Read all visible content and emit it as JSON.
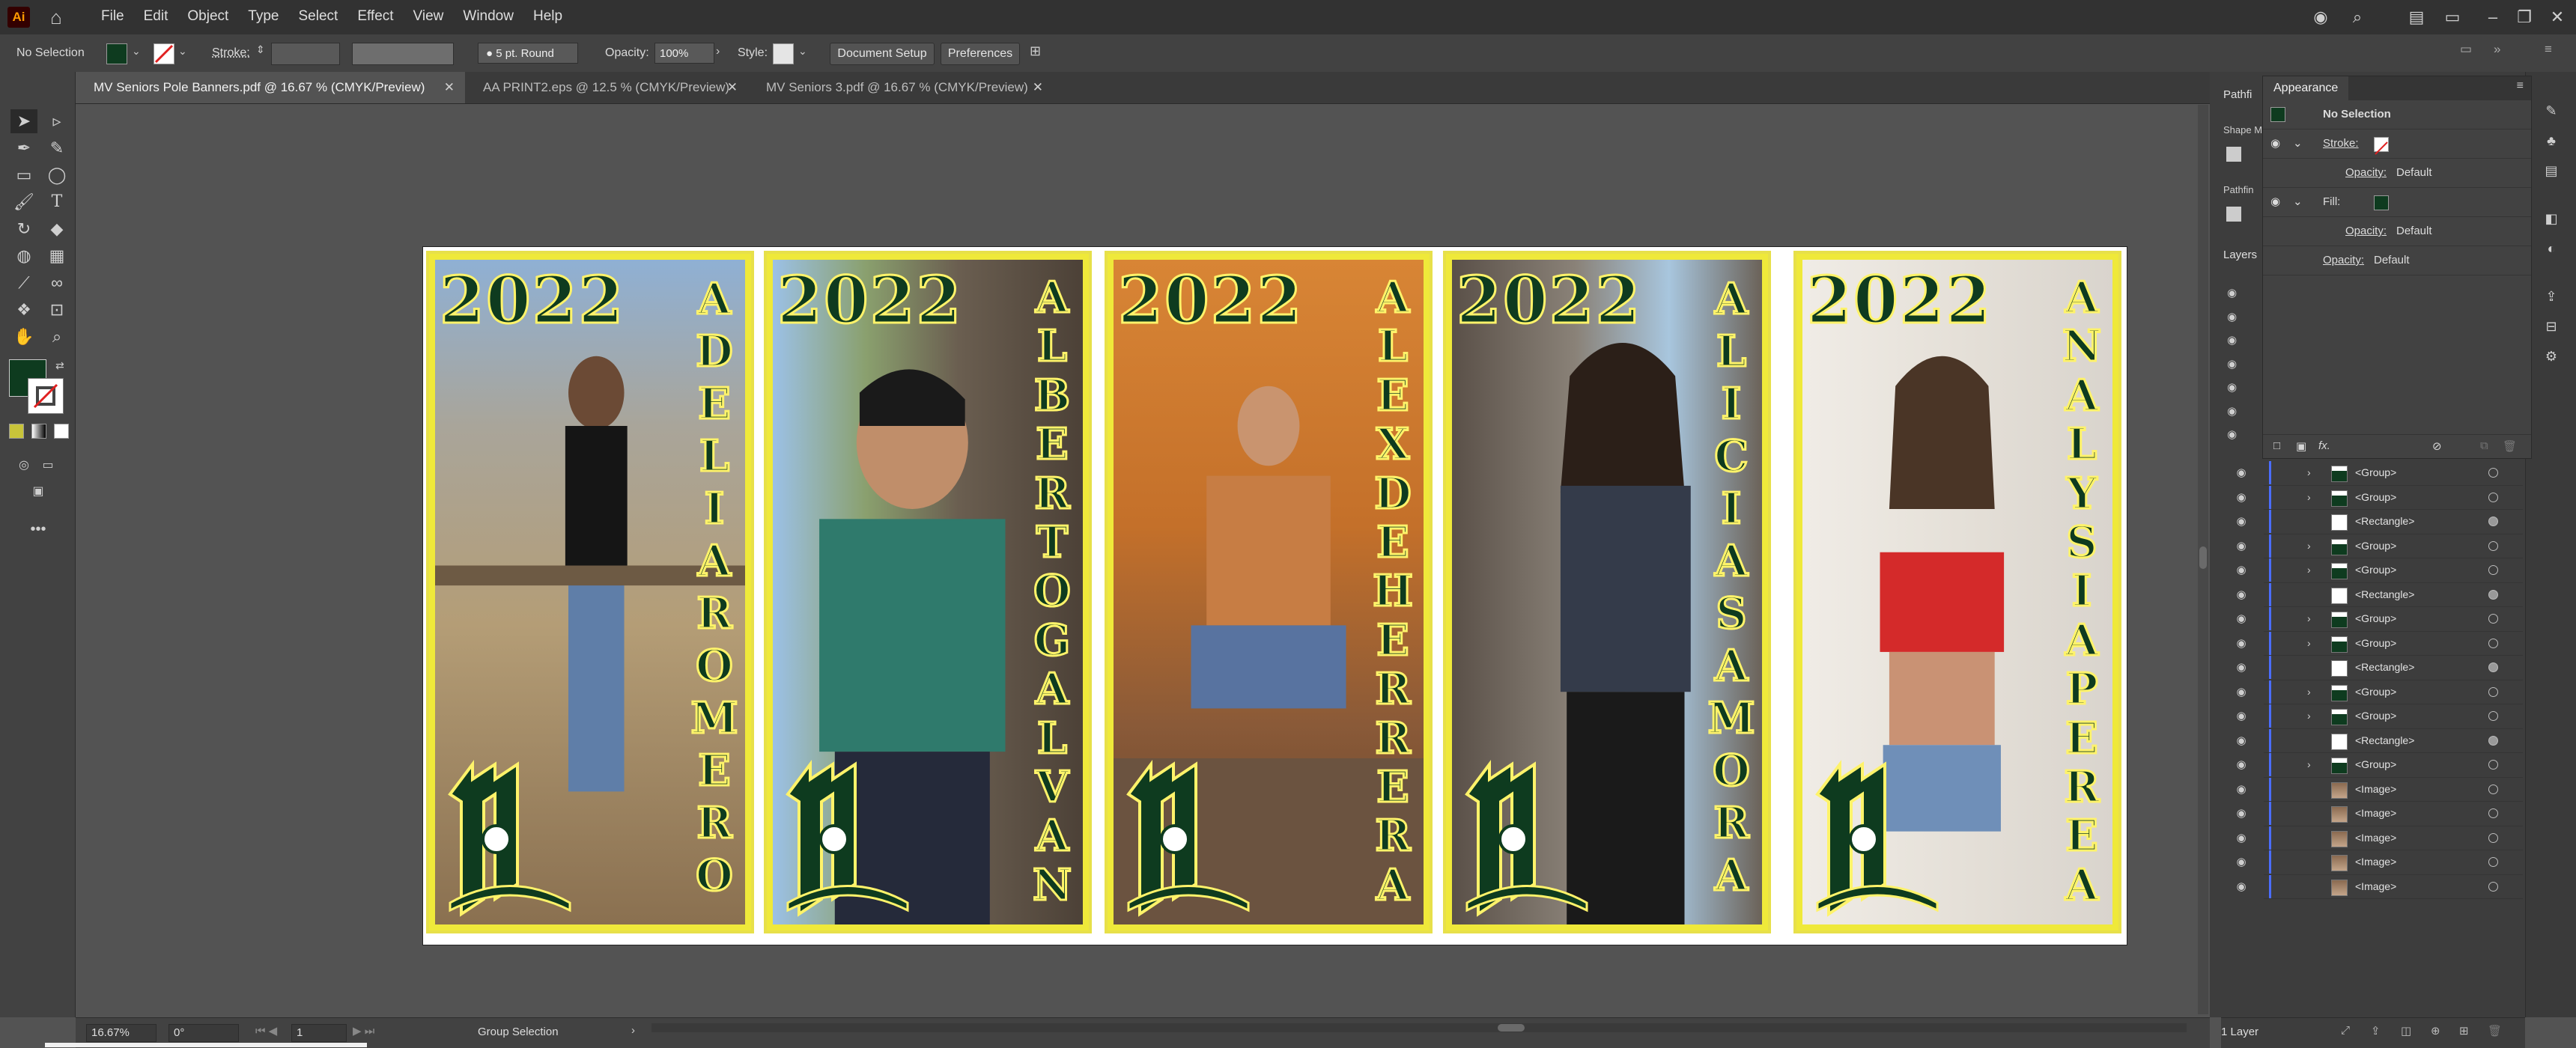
{
  "app": {
    "logo": "Ai"
  },
  "menu": [
    "File",
    "Edit",
    "Object",
    "Type",
    "Select",
    "Effect",
    "View",
    "Window",
    "Help"
  ],
  "control_bar": {
    "selection": "No Selection",
    "stroke_label": "Stroke:",
    "brush": "5 pt. Round",
    "opacity_label": "Opacity:",
    "opacity_value": "100%",
    "style_label": "Style:",
    "document_setup": "Document Setup",
    "preferences": "Preferences"
  },
  "tabs": [
    {
      "label": "MV Seniors Pole Banners.pdf @ 16.67 % (CMYK/Preview)",
      "active": true
    },
    {
      "label": "AA PRINT2.eps @ 12.5 % (CMYK/Preview)",
      "active": false
    },
    {
      "label": "MV Seniors 3.pdf @ 16.67 % (CMYK/Preview)",
      "active": false
    }
  ],
  "banners": [
    {
      "year": "2022",
      "name": [
        "A",
        "D",
        "E",
        "L",
        "I",
        "A",
        "R",
        "O",
        "M",
        "E",
        "R",
        "O"
      ],
      "bg": "#b7a487"
    },
    {
      "year": "2022",
      "name": [
        "A",
        "L",
        "B",
        "E",
        "R",
        "T",
        "O",
        "G",
        "A",
        "L",
        "V",
        "A",
        "N"
      ],
      "bg": "#8c8a7f"
    },
    {
      "year": "2022",
      "name": [
        "A",
        "L",
        "E",
        "X",
        "D",
        "E",
        "H",
        "E",
        "R",
        "R",
        "E",
        "R",
        "A"
      ],
      "bg": "#c47a2f"
    },
    {
      "year": "2022",
      "name": [
        "A",
        "L",
        "I",
        "C",
        "I",
        "A",
        "S",
        "A",
        "M",
        "O",
        "R",
        "A"
      ],
      "bg": "#6c6660"
    },
    {
      "year": "2022",
      "name": [
        "A",
        "N",
        "A",
        "L",
        "Y",
        "S",
        "I",
        "A",
        "P",
        "E",
        "R",
        "E",
        "A"
      ],
      "bg": "#e7e2dc"
    }
  ],
  "appearance": {
    "title": "Appearance",
    "selection": "No Selection",
    "stroke_label": "Stroke:",
    "opacity_label": "Opacity:",
    "opacity_value": "Default",
    "fill_label": "Fill:",
    "fx_label": "fx."
  },
  "side_tabs": {
    "pathfinder": "Pathfi",
    "shape_modes": "Shape M",
    "pathfinders": "Pathfin",
    "layers": "Layers"
  },
  "layers": [
    {
      "name": "<Group>",
      "kind": "group"
    },
    {
      "name": "<Group>",
      "kind": "group"
    },
    {
      "name": "<Rectangle>",
      "kind": "rect"
    },
    {
      "name": "<Group>",
      "kind": "group"
    },
    {
      "name": "<Group>",
      "kind": "group"
    },
    {
      "name": "<Rectangle>",
      "kind": "rect"
    },
    {
      "name": "<Group>",
      "kind": "group"
    },
    {
      "name": "<Group>",
      "kind": "group"
    },
    {
      "name": "<Rectangle>",
      "kind": "rect"
    },
    {
      "name": "<Group>",
      "kind": "group"
    },
    {
      "name": "<Group>",
      "kind": "group"
    },
    {
      "name": "<Rectangle>",
      "kind": "rect"
    },
    {
      "name": "<Group>",
      "kind": "group"
    },
    {
      "name": "<Image>",
      "kind": "image"
    },
    {
      "name": "<Image>",
      "kind": "image"
    },
    {
      "name": "<Image>",
      "kind": "image"
    },
    {
      "name": "<Image>",
      "kind": "image"
    },
    {
      "name": "<Image>",
      "kind": "image"
    }
  ],
  "layers_footer": "1 Layer",
  "status": {
    "zoom": "16.67%",
    "rotation": "0°",
    "artboard": "1",
    "tool": "Group Selection"
  },
  "colors": {
    "banner_green": "#0e3b1f",
    "banner_yellow": "#efe93a",
    "fill_swatch": "#0e3b1f"
  }
}
